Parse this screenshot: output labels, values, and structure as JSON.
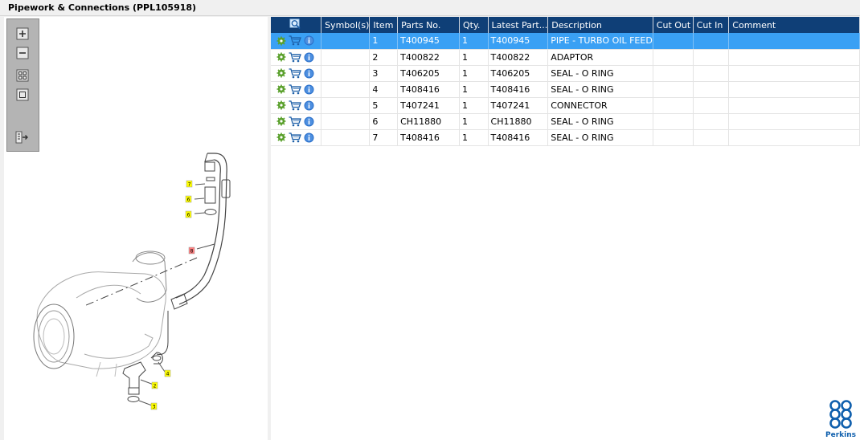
{
  "window": {
    "title": "Pipework & Connections (PPL105918)"
  },
  "toolbar": {
    "buttons": [
      {
        "icon": "zoom-in-icon"
      },
      {
        "icon": "zoom-out-icon"
      },
      {
        "icon": "fit-all-icon"
      },
      {
        "icon": "actual-size-icon"
      },
      {
        "icon": "export-list-icon"
      }
    ]
  },
  "diagram": {
    "callouts": [
      {
        "label": "7",
        "color": "#ffff00"
      },
      {
        "label": "6",
        "color": "#ffff00"
      },
      {
        "label": "6",
        "color": "#ffff00"
      },
      {
        "label": "8",
        "color": "#ff8080"
      },
      {
        "label": "4",
        "color": "#ffff00"
      },
      {
        "label": "2",
        "color": "#ffff00"
      },
      {
        "label": "3",
        "color": "#ffff00"
      }
    ]
  },
  "table": {
    "columns": [
      "",
      "Symbol(s)",
      "Item",
      "Parts No.",
      "Qty.",
      "Latest Part...",
      "Description",
      "Cut Out",
      "Cut In",
      "Comment"
    ],
    "rows": [
      {
        "item": "1",
        "part": "T400945",
        "qty": "1",
        "latest": "T400945",
        "desc": "PIPE - TURBO OIL FEED",
        "selected": true
      },
      {
        "item": "2",
        "part": "T400822",
        "qty": "1",
        "latest": "T400822",
        "desc": "ADAPTOR"
      },
      {
        "item": "3",
        "part": "T406205",
        "qty": "1",
        "latest": "T406205",
        "desc": "SEAL - O RING"
      },
      {
        "item": "4",
        "part": "T408416",
        "qty": "1",
        "latest": "T408416",
        "desc": "SEAL - O RING"
      },
      {
        "item": "5",
        "part": "T407241",
        "qty": "1",
        "latest": "T407241",
        "desc": "CONNECTOR"
      },
      {
        "item": "6",
        "part": "CH11880",
        "qty": "1",
        "latest": "CH11880",
        "desc": "SEAL - O RING"
      },
      {
        "item": "7",
        "part": "T408416",
        "qty": "1",
        "latest": "T408416",
        "desc": "SEAL - O RING"
      }
    ]
  },
  "brand": {
    "name": "Perkins",
    "color": "#0f5fad"
  },
  "colors": {
    "header": "#0f3f77",
    "selected": "#3aa0f4",
    "gear": "#5aa02c"
  }
}
